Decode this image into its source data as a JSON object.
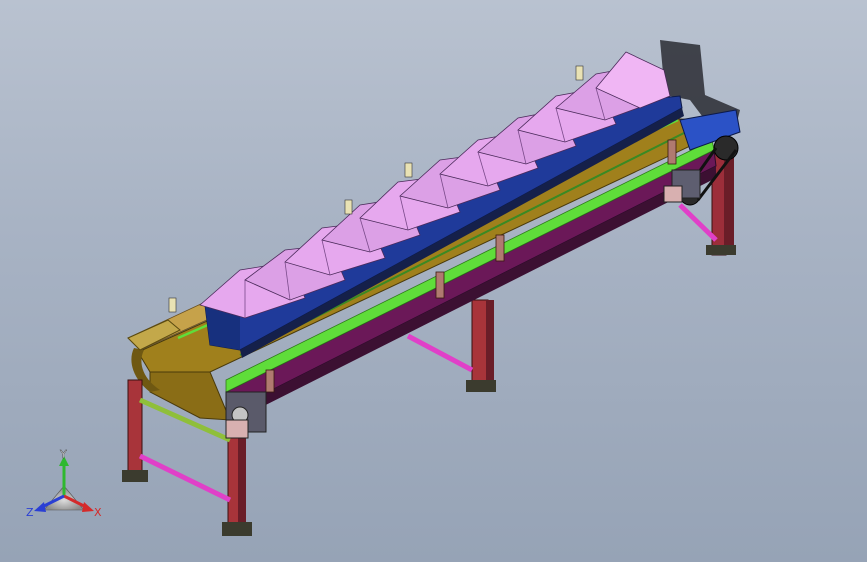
{
  "viewport": {
    "background_top": "#b9c2d0",
    "background_bottom": "#96a3b6",
    "model": "belt-conveyor-with-hopper-bins"
  },
  "triad": {
    "x_label": "X",
    "y_label": "Y",
    "z_label": "Z",
    "x_color": "#d42a2a",
    "y_color": "#2fb82f",
    "z_color": "#2a3fd4"
  },
  "colors": {
    "belt": "#a0801c",
    "frame_green": "#5fdd3a",
    "legs": "#b23a3a",
    "brace_pink": "#e040c8",
    "bins": "#e6a8ee",
    "side_rail_dark": "#223c8a",
    "shadow": "#1a1a22"
  }
}
